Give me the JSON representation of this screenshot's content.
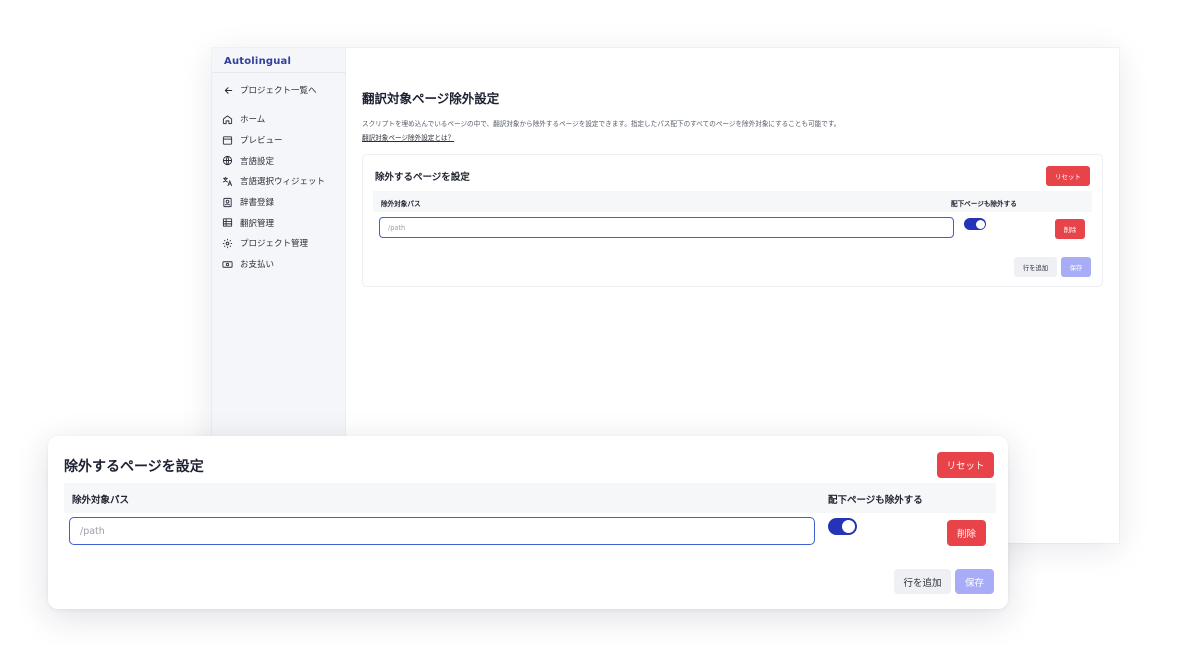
{
  "app": {
    "brand": "Autolingual"
  },
  "sidebar": {
    "back_label": "プロジェクト一覧へ",
    "items": [
      {
        "label": "ホーム",
        "icon": "home-icon"
      },
      {
        "label": "プレビュー",
        "icon": "browser-window-icon"
      },
      {
        "label": "言語設定",
        "icon": "globe-icon"
      },
      {
        "label": "言語選択ウィジェット",
        "icon": "translate-icon"
      },
      {
        "label": "辞書登録",
        "icon": "contact-book-icon"
      },
      {
        "label": "翻訳管理",
        "icon": "table-icon"
      },
      {
        "label": "プロジェクト管理",
        "icon": "gear-icon"
      },
      {
        "label": "お支払い",
        "icon": "banknote-icon"
      }
    ]
  },
  "main": {
    "title": "翻訳対象ページ除外設定",
    "description": "スクリプトを埋め込んでいるページの中で、翻訳対象から除外するページを設定できます。指定したパス配下のすべてのページを除外対象にすることも可能です。",
    "help_link": "翻訳対象ページ除外設定とは？"
  },
  "exclude_card": {
    "title": "除外するページを設定",
    "reset_label": "リセット",
    "columns": {
      "path": "除外対象パス",
      "include_children": "配下ページも除外する"
    },
    "rows": [
      {
        "path_value": "",
        "path_placeholder": "/path",
        "include_children": true,
        "delete_label": "削除"
      }
    ],
    "add_row_label": "行を追加",
    "save_label": "保存"
  },
  "colors": {
    "accent": "#2433b8",
    "danger": "#e9434a",
    "save_disabled": "#a8acf6",
    "focus_border": "#3f60d4",
    "brand": "#2f3f9a"
  }
}
